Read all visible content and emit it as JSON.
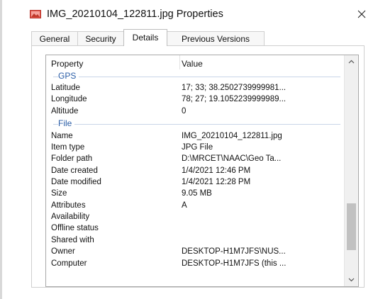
{
  "window": {
    "title": "IMG_20210104_122811.jpg Properties",
    "close_glyph": "✕",
    "icon": "image-file-icon",
    "accent": "#d9423a"
  },
  "tabs": [
    {
      "label": "General",
      "active": false
    },
    {
      "label": "Security",
      "active": false
    },
    {
      "label": "Details",
      "active": true
    },
    {
      "label": "Previous Versions",
      "active": false
    }
  ],
  "details": {
    "columns": {
      "property": "Property",
      "value": "Value"
    },
    "groups": [
      {
        "name": "GPS",
        "rows": [
          {
            "property": "Latitude",
            "value": "17; 33; 38.2502739999981..."
          },
          {
            "property": "Longitude",
            "value": "78; 27; 19.1052239999989..."
          },
          {
            "property": "Altitude",
            "value": "0"
          }
        ]
      },
      {
        "name": "File",
        "rows": [
          {
            "property": "Name",
            "value": "IMG_20210104_122811.jpg"
          },
          {
            "property": "Item type",
            "value": "JPG File"
          },
          {
            "property": "Folder path",
            "value": "D:\\MRCET\\NAAC\\Geo Ta..."
          },
          {
            "property": "Date created",
            "value": "1/4/2021 12:46 PM"
          },
          {
            "property": "Date modified",
            "value": "1/4/2021 12:28 PM"
          },
          {
            "property": "Size",
            "value": "9.05 MB"
          },
          {
            "property": "Attributes",
            "value": "A"
          },
          {
            "property": "Availability",
            "value": ""
          },
          {
            "property": "Offline status",
            "value": ""
          },
          {
            "property": "Shared with",
            "value": ""
          },
          {
            "property": "Owner",
            "value": "DESKTOP-H1M7JFS\\NUS..."
          },
          {
            "property": "Computer",
            "value": "DESKTOP-H1M7JFS (this ..."
          }
        ]
      }
    ],
    "scrollbar": {
      "position": 0.86,
      "visible_fraction": 0.23
    }
  }
}
